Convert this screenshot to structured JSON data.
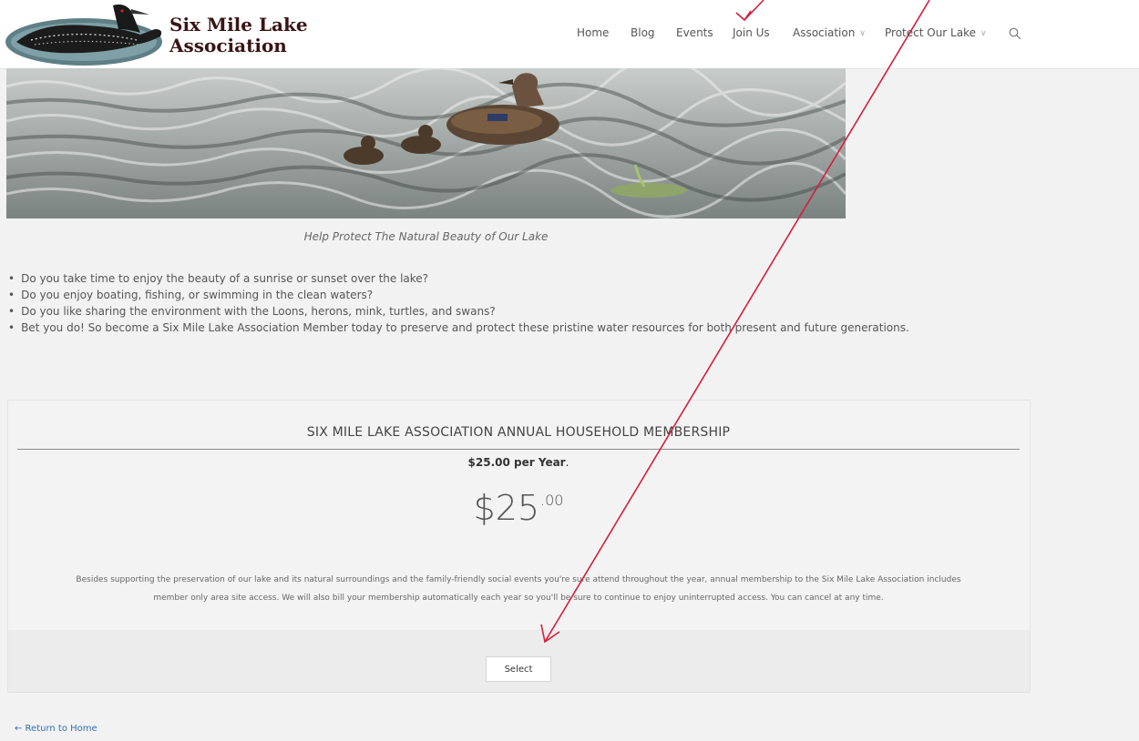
{
  "header": {
    "logo_line1": "Six Mile Lake",
    "logo_line2": "Association",
    "nav": [
      {
        "label": "Home",
        "has_dropdown": false
      },
      {
        "label": "Blog",
        "has_dropdown": false
      },
      {
        "label": "Events",
        "has_dropdown": false
      },
      {
        "label": "Join Us",
        "has_dropdown": false
      },
      {
        "label": "Association",
        "has_dropdown": true
      },
      {
        "label": "Protect Our Lake",
        "has_dropdown": true
      }
    ],
    "search_icon": "search-icon",
    "chevron_icon": "chevron-down-icon"
  },
  "hero": {
    "caption": "Help Protect The Natural Beauty of Our Lake"
  },
  "bullets": [
    "Do you take  time to enjoy the beauty of a sunrise or sunset over the lake?",
    "Do you enjoy boating, fishing, or swimming in the clean waters?",
    "Do you like sharing the environment with the Loons, herons, mink, turtles, and swans?",
    "Bet you do!  So become a Six Mile Lake Association Member today to preserve and protect these pristine water resources for both present and future generations."
  ],
  "membership": {
    "title": "SIX MILE LAKE ASSOCIATION ANNUAL HOUSEHOLD MEMBERSHIP",
    "price_sub": "$25.00 per Year",
    "price_sub_period": ".",
    "price_whole": "$25",
    "price_cents": ".00",
    "description_line1": "Besides supporting the preservation of our lake and its natural surroundings and the family-friendly social events you're sure attend throughout the year, annual membership to the Six Mile Lake Association includes",
    "description_line2": "member only area site access. We will also bill your membership automatically each year so you'll be sure to continue to enjoy uninterrupted access.  You can cancel at any time.",
    "select_label": "Select"
  },
  "footer": {
    "return_link": "← Return to Home"
  },
  "colors": {
    "annotation_arrow": "#d21f3c",
    "logo_text": "#3a1414",
    "link": "#2f6fb3"
  }
}
